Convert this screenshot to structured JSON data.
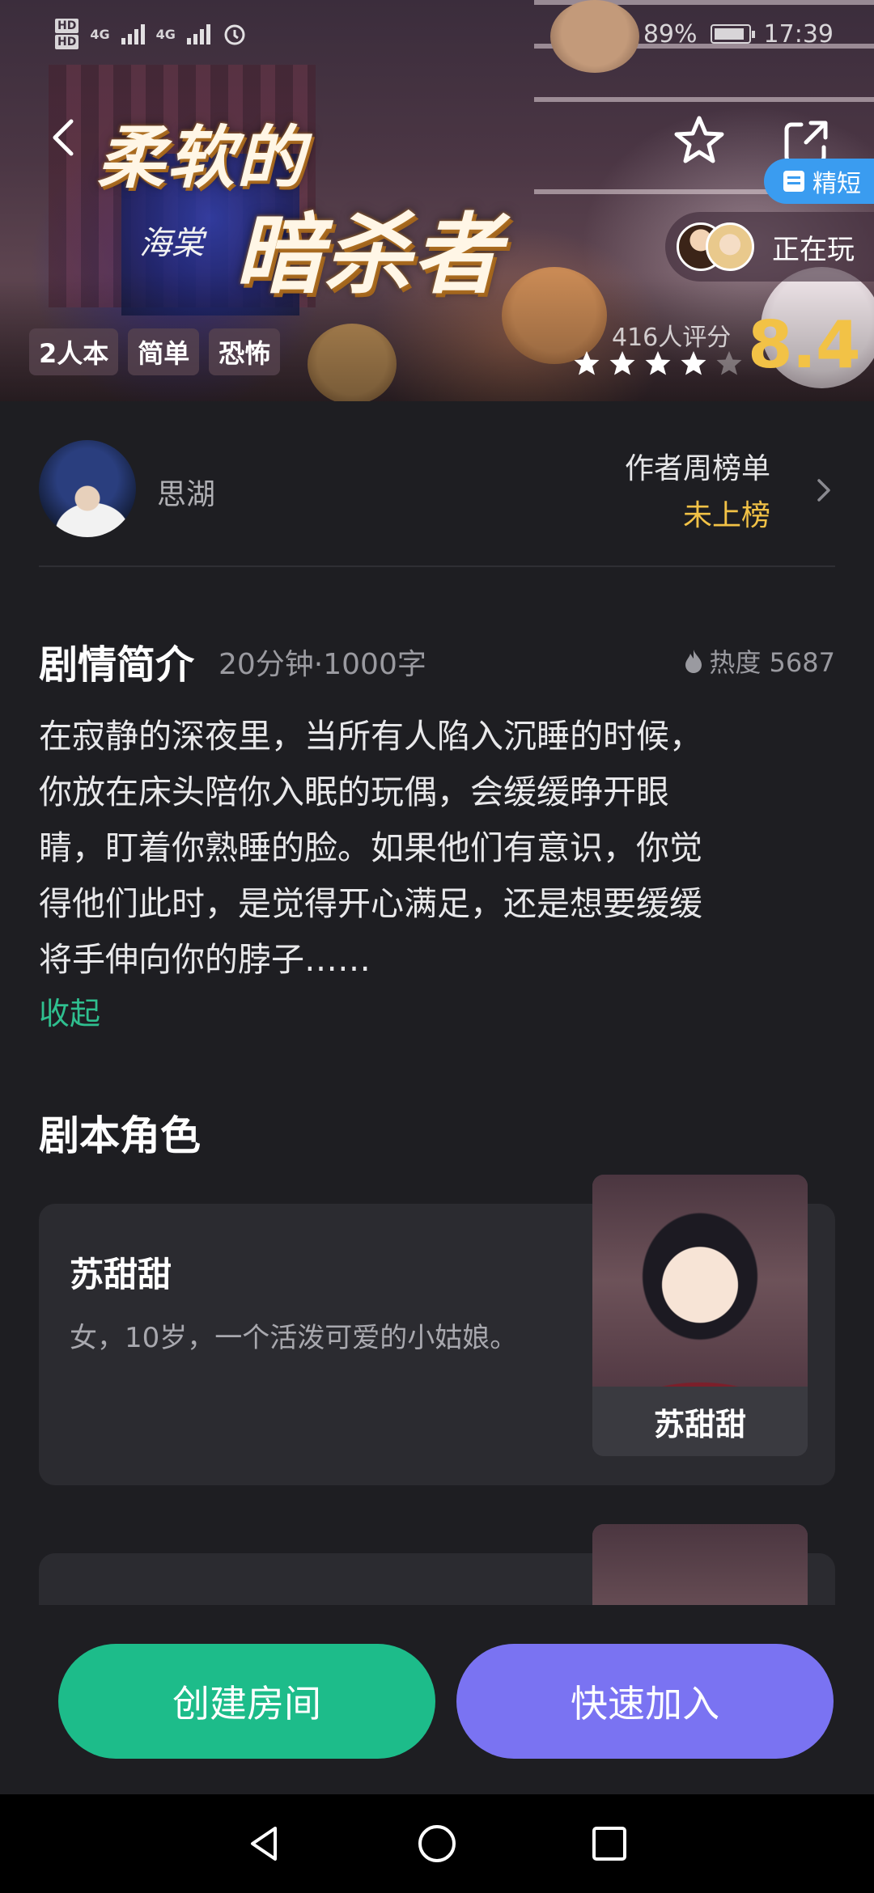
{
  "status_bar": {
    "hd_labels": [
      "HD",
      "HD"
    ],
    "network_1": "4G",
    "network_2": "4G",
    "battery": "89%",
    "time": "17:39"
  },
  "hero": {
    "title_line1": "柔软的",
    "title_line2": "暗杀者",
    "signature": "海棠",
    "badge": "精短",
    "playing_label": "正在玩",
    "tags": [
      "2人本",
      "简单",
      "恐怖"
    ],
    "rating_count": "416人评分",
    "rating_score": "8.4",
    "stars_filled": 4,
    "stars_total": 5
  },
  "author": {
    "name": "思湖",
    "rank_title": "作者周榜单",
    "rank_value": "未上榜"
  },
  "intro": {
    "title": "剧情简介",
    "meta": "20分钟·1000字",
    "heat": "热度 5687",
    "body_lines": [
      "在寂静的深夜里，当所有人陷入沉睡的时候，",
      "你放在床头陪你入眠的玩偶，会缓缓睁开眼",
      "睛，盯着你熟睡的脸。如果他们有意识，你觉",
      "得他们此时，是觉得开心满足，还是想要缓缓",
      "将手伸向你的脖子……"
    ],
    "collapse": "收起"
  },
  "roles": {
    "title": "剧本角色",
    "items": [
      {
        "name": "苏甜甜",
        "desc": "女，10岁，一个活泼可爱的小姑娘。",
        "portrait_label": "苏甜甜"
      },
      {
        "name": "",
        "desc": "",
        "portrait_label": ""
      }
    ]
  },
  "actions": {
    "create": "创建房间",
    "join": "快速加入"
  },
  "colors": {
    "accent_green": "#1dbc8a",
    "accent_purple": "#7a73f2",
    "rating_gold": "#f2c246",
    "link_green": "#2fbf8f",
    "badge_blue": "#3a9cf0"
  }
}
